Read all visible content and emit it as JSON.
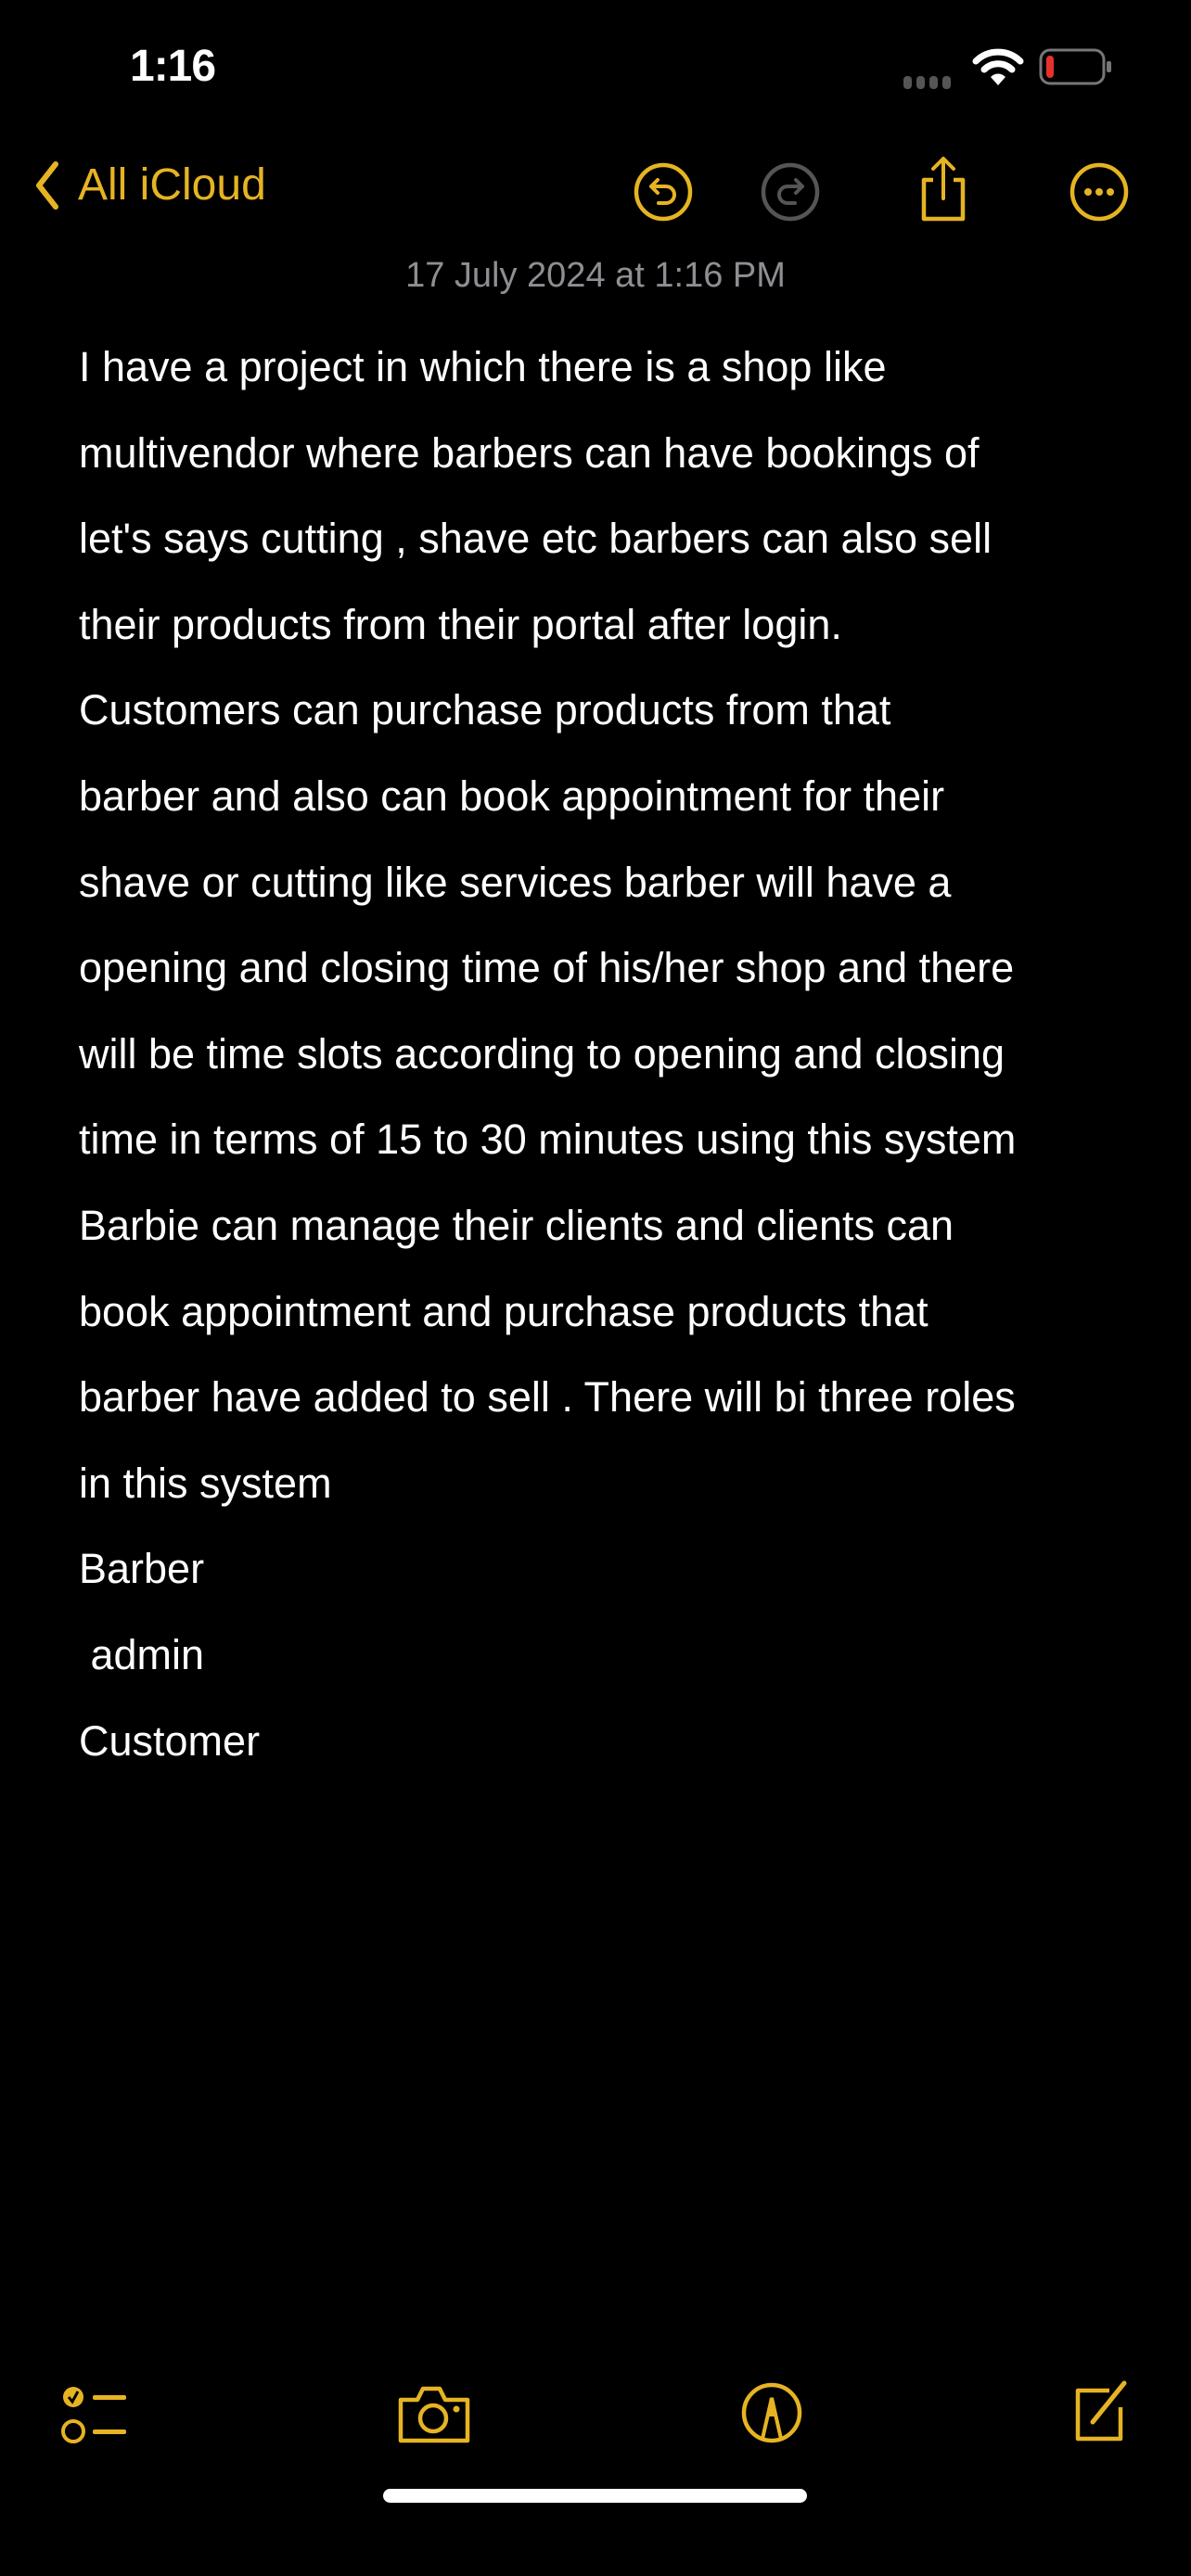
{
  "status_bar": {
    "time": "1:16",
    "battery_color": "#e5322d"
  },
  "nav": {
    "back_label": "All iCloud",
    "accent": "#e6b422",
    "disabled_color": "#555555",
    "icons": [
      "chevron-left-icon",
      "undo-icon",
      "redo-icon",
      "share-icon",
      "more-icon"
    ]
  },
  "note": {
    "date": "17 July 2024 at 1:16 PM",
    "lines": [
      "I have a project in which there is a shop like",
      "multivendor where barbers can have bookings of",
      "let's says cutting , shave etc barbers can also sell",
      "their products from their portal after login.",
      "Customers can purchase products from that",
      "barber and also can book appointment for their",
      "shave or cutting like services barber will have a",
      "opening and closing time of his/her shop and there",
      "will be time slots according to opening and closing",
      "time in terms of 15 to 30 minutes using this system",
      "Barbie can manage their clients and clients can",
      "book appointment and purchase products that",
      "barber have added to sell . There will bi three roles",
      "in this system",
      "Barber",
      " admin",
      "Customer"
    ]
  },
  "toolbar": {
    "icons": [
      "checklist-icon",
      "camera-icon",
      "markup-icon",
      "compose-icon"
    ]
  }
}
